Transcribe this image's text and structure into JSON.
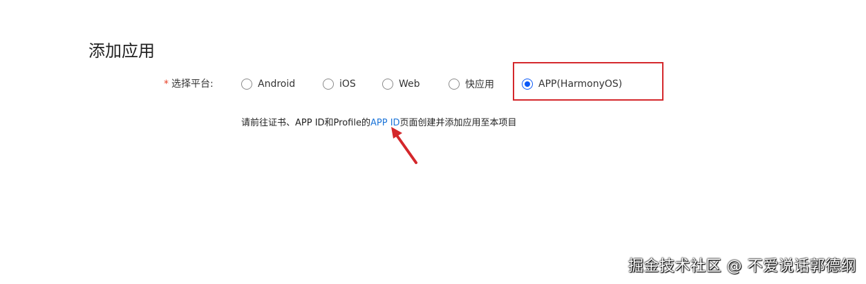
{
  "page": {
    "title": "添加应用"
  },
  "platform_field": {
    "required_mark": "*",
    "label": "选择平台:",
    "options": [
      {
        "label": "Android",
        "selected": false
      },
      {
        "label": "iOS",
        "selected": false
      },
      {
        "label": "Web",
        "selected": false
      },
      {
        "label": "快应用",
        "selected": false
      },
      {
        "label": "APP(HarmonyOS)",
        "selected": true
      }
    ]
  },
  "hint": {
    "prefix": "请前往证书、APP ID和Profile的",
    "link_text": "APP ID",
    "suffix": "页面创建并添加应用至本项目"
  },
  "annotations": {
    "highlight_color": "#d4272b",
    "arrow_color": "#d4272b"
  },
  "watermark": {
    "text": "掘金技术社区 @ 不爱说话郭德纲"
  }
}
